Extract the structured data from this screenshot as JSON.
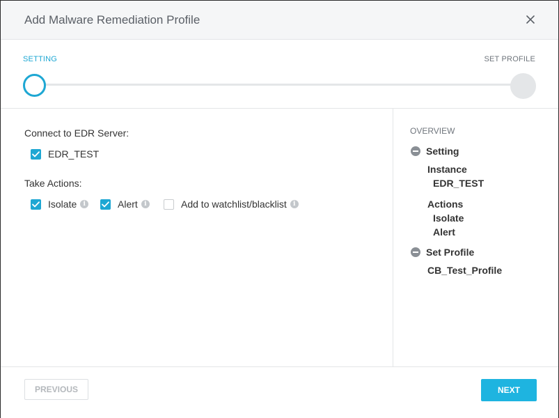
{
  "dialog": {
    "title": "Add Malware Remediation Profile"
  },
  "stepper": {
    "steps": [
      {
        "label": "SETTING",
        "state": "active"
      },
      {
        "label": "SET PROFILE",
        "state": "inactive"
      }
    ]
  },
  "form": {
    "connect_label": "Connect to EDR Server:",
    "servers": [
      {
        "label": "EDR_TEST",
        "checked": true
      }
    ],
    "actions_label": "Take Actions:",
    "actions": [
      {
        "label": "Isolate",
        "checked": true
      },
      {
        "label": "Alert",
        "checked": true
      },
      {
        "label": "Add to watchlist/blacklist",
        "checked": false
      }
    ]
  },
  "overview": {
    "title": "OVERVIEW",
    "setting_label": "Setting",
    "instance_label": "Instance",
    "instance_value": "EDR_TEST",
    "actions_label": "Actions",
    "actions_values": [
      "Isolate",
      "Alert"
    ],
    "profile_label": "Set Profile",
    "profile_value": "CB_Test_Profile"
  },
  "footer": {
    "previous_label": "PREVIOUS",
    "next_label": "NEXT"
  },
  "colors": {
    "accent": "#1ea7d3",
    "button_primary": "#1eb4e0"
  },
  "icons": {
    "close": "close-icon",
    "checkbox": "checkmark-icon",
    "info": "info-icon",
    "collapse": "minus-circle-icon"
  }
}
